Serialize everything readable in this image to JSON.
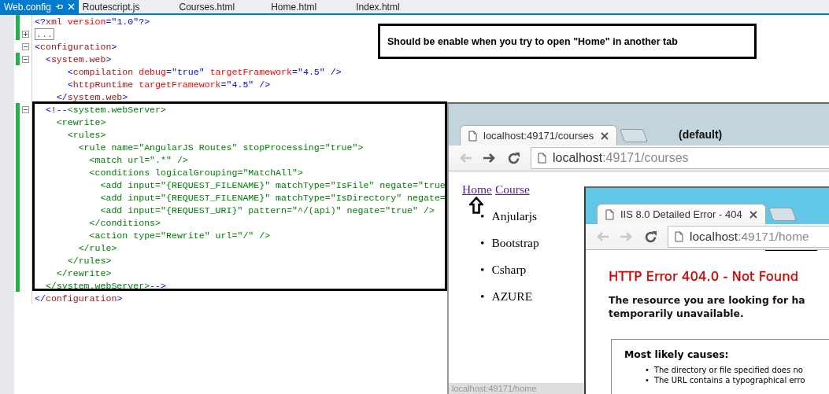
{
  "editor": {
    "tabs": [
      {
        "label": "Web.config",
        "selected": true
      },
      {
        "label": "Routescript.js",
        "selected": false
      },
      {
        "label": "Courses.html",
        "selected": false
      },
      {
        "label": "Home.html",
        "selected": false
      },
      {
        "label": "Index.html",
        "selected": false
      }
    ],
    "lines": [
      {
        "changed": true,
        "segments": [
          {
            "kind": "delim",
            "text": "<?"
          },
          {
            "kind": "name",
            "text": "xml"
          },
          {
            "kind": "attr",
            "text": " version"
          },
          {
            "kind": "delim",
            "text": "=\"1.0\"?>"
          }
        ]
      },
      {
        "changed": true,
        "expanded": false,
        "segments": [
          {
            "kind": "collapsed",
            "text": "..."
          }
        ]
      },
      {
        "changed": false,
        "expanded": true,
        "segments": [
          {
            "kind": "delim",
            "text": "<"
          },
          {
            "kind": "name",
            "text": "configuration"
          },
          {
            "kind": "delim",
            "text": ">"
          }
        ]
      },
      {
        "changed": true,
        "expanded": true,
        "segments": [
          {
            "kind": "delim",
            "text": "  <"
          },
          {
            "kind": "name",
            "text": "system.web"
          },
          {
            "kind": "delim",
            "text": ">"
          }
        ]
      },
      {
        "changed": false,
        "segments": [
          {
            "kind": "delim",
            "text": "      <"
          },
          {
            "kind": "name",
            "text": "compilation"
          },
          {
            "kind": "attr",
            "text": " debug"
          },
          {
            "kind": "delim",
            "text": "=\"true\""
          },
          {
            "kind": "attr",
            "text": " targetFramework"
          },
          {
            "kind": "delim",
            "text": "=\"4.5\" />"
          }
        ]
      },
      {
        "changed": false,
        "segments": [
          {
            "kind": "delim",
            "text": "      <"
          },
          {
            "kind": "name",
            "text": "httpRuntime"
          },
          {
            "kind": "attr",
            "text": " targetFramework"
          },
          {
            "kind": "delim",
            "text": "=\"4.5\" />"
          }
        ]
      },
      {
        "changed": false,
        "segments": [
          {
            "kind": "delim",
            "text": "    </"
          },
          {
            "kind": "name",
            "text": "system.web"
          },
          {
            "kind": "delim",
            "text": ">"
          }
        ]
      },
      {
        "changed": true,
        "expanded": true,
        "segments": [
          {
            "kind": "delim",
            "text": "  <!--"
          },
          {
            "kind": "comment",
            "text": "<system.webServer>"
          }
        ]
      },
      {
        "changed": true,
        "segments": [
          {
            "kind": "comment",
            "text": "    <rewrite>"
          }
        ]
      },
      {
        "changed": true,
        "segments": [
          {
            "kind": "comment",
            "text": "      <rules>"
          }
        ]
      },
      {
        "changed": true,
        "segments": [
          {
            "kind": "comment",
            "text": "        <rule name=\"AngularJS Routes\" stopProcessing=\"true\">"
          }
        ]
      },
      {
        "changed": true,
        "segments": [
          {
            "kind": "comment",
            "text": "          <match url=\".*\" />"
          }
        ]
      },
      {
        "changed": true,
        "segments": [
          {
            "kind": "comment",
            "text": "          <conditions logicalGrouping=\"MatchAll\">"
          }
        ]
      },
      {
        "changed": true,
        "segments": [
          {
            "kind": "comment",
            "text": "            <add input=\"{REQUEST_FILENAME}\" matchType=\"IsFile\" negate=\"true"
          }
        ]
      },
      {
        "changed": true,
        "segments": [
          {
            "kind": "comment",
            "text": "            <add input=\"{REQUEST_FILENAME}\" matchType=\"IsDirectory\" negate="
          }
        ]
      },
      {
        "changed": true,
        "segments": [
          {
            "kind": "comment",
            "text": "            <add input=\"{REQUEST_URI}\" pattern=\"^/(api)\" negate=\"true\" />"
          }
        ]
      },
      {
        "changed": true,
        "segments": [
          {
            "kind": "comment",
            "text": "          </conditions>"
          }
        ]
      },
      {
        "changed": true,
        "segments": [
          {
            "kind": "comment",
            "text": "          <action type=\"Rewrite\" url=\"/\" />"
          }
        ]
      },
      {
        "changed": true,
        "segments": [
          {
            "kind": "comment",
            "text": "        </rule>"
          }
        ]
      },
      {
        "changed": true,
        "segments": [
          {
            "kind": "comment",
            "text": "      </rules>"
          }
        ]
      },
      {
        "changed": true,
        "segments": [
          {
            "kind": "comment",
            "text": "    </rewrite>"
          }
        ]
      },
      {
        "changed": true,
        "segments": [
          {
            "kind": "comment",
            "text": "  </system.webServer>"
          },
          {
            "kind": "delim",
            "text": "-->"
          }
        ]
      },
      {
        "changed": false,
        "segments": [
          {
            "kind": "delim",
            "text": "</"
          },
          {
            "kind": "name",
            "text": "configuration"
          },
          {
            "kind": "delim",
            "text": ">"
          }
        ]
      }
    ]
  },
  "note": {
    "text": "Should be enable when you try to open \"Home\" in another tab"
  },
  "browsers": [
    {
      "kind": "links",
      "focused": false,
      "tab_title": "localhost:49171/courses",
      "profile_label": "(default)",
      "back_enabled": false,
      "forward_enabled": true,
      "url": {
        "host": "localhost",
        "path": ":49171/courses"
      },
      "links": [
        "Home",
        "Course"
      ],
      "marker": "•",
      "items": [
        "Anjularjs",
        "Bootstrap",
        "Csharp",
        "AZURE"
      ],
      "status": "localhost:49171/home"
    },
    {
      "kind": "error",
      "focused": true,
      "tab_title": "IIS 8.0 Detailed Error - 404",
      "back_enabled": false,
      "forward_enabled": false,
      "url": {
        "host": "localhost",
        "path": ":49171/home"
      },
      "heading": "HTTP Error 404.0 - Not Found",
      "message": [
        "The resource you are looking for ha",
        "temporarily unavailable."
      ],
      "causes_title": "Most likely causes:",
      "marker": "•",
      "causes": [
        "The directory or file specified does no",
        "The URL contains a typographical erro"
      ]
    }
  ]
}
